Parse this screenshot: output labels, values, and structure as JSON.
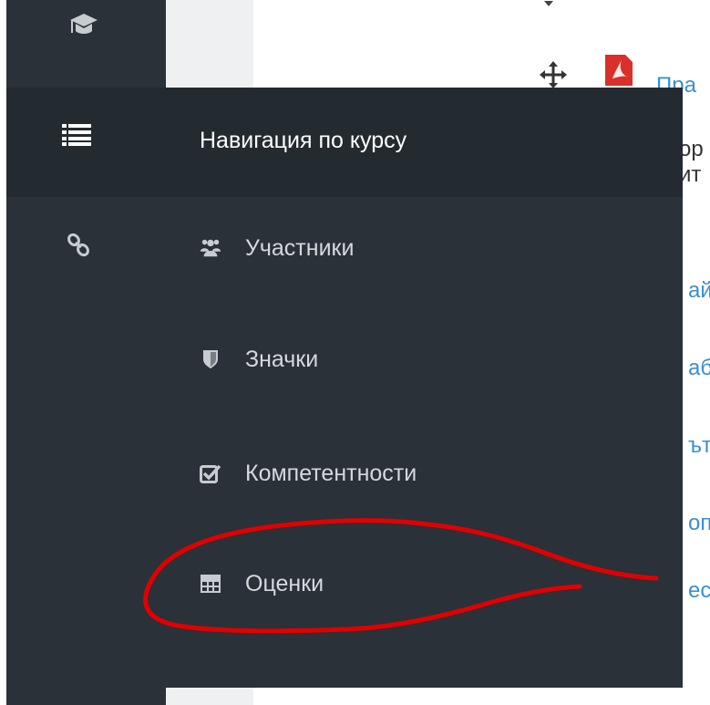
{
  "background_page": {
    "link_fragments": [
      "Пра",
      "ай",
      "аб",
      "ътп",
      "оп",
      "ес"
    ],
    "text_fragments": [
      "ор",
      "ит"
    ]
  },
  "rail": {
    "icons": [
      "graduation-cap-icon",
      "list-icon",
      "link-icon"
    ]
  },
  "flyout": {
    "title": "Навигация по курсу",
    "items": [
      {
        "label": "Участники",
        "icon": "users-icon"
      },
      {
        "label": "Значки",
        "icon": "shield-icon"
      },
      {
        "label": "Компетентности",
        "icon": "checkbox-icon"
      },
      {
        "label": "Оценки",
        "icon": "table-icon"
      }
    ]
  },
  "colors": {
    "rail": "#2a3138",
    "flyout_header": "#232a30",
    "link": "#3a8fd0",
    "annotation": "#e10000"
  }
}
